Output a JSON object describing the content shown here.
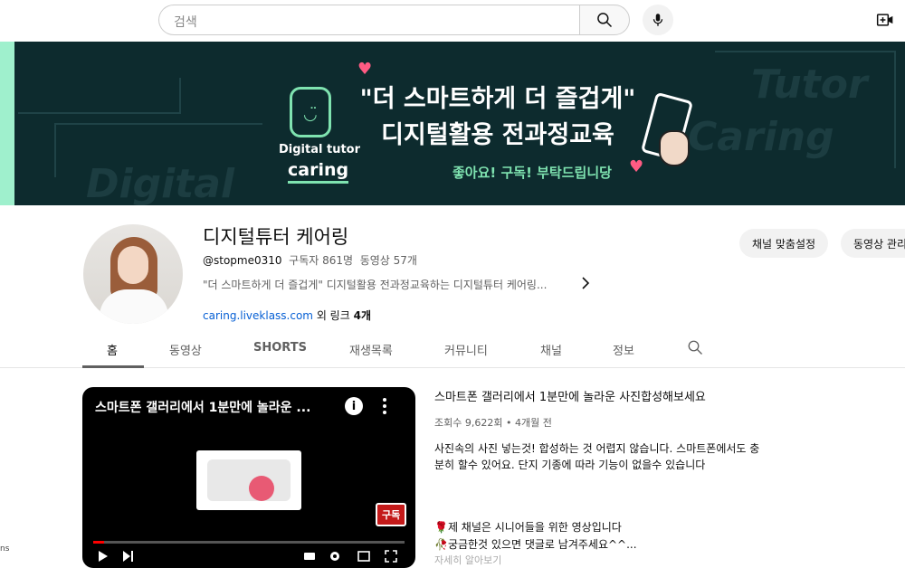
{
  "search": {
    "placeholder": "검색"
  },
  "banner": {
    "headline_line1": "\"더 스마트하게 더 즐겁게\"",
    "headline_line2": "디지털활용 전과정교육",
    "slogan": "좋아요! 구독! 부탁드립니당",
    "logo_tutor": "Digital tutor",
    "logo_caring": "caring",
    "bg_words": [
      "Digital",
      "Tutor",
      "Caring"
    ],
    "colors": {
      "background": "#0d2b2e",
      "accent": "#7fe3b0",
      "stripe": "#9ff0cd"
    }
  },
  "channel": {
    "name": "디지털튜터 케어링",
    "handle": "@stopme0310",
    "subscribers": "구독자 861명",
    "videos": "동영상 57개",
    "description": "\"더 스마트하게 더 즐겁게\" 디지털활용 전과정교육하는 디지털튜터 케어링...",
    "link": "caring.liveklass.com",
    "link_more": "외 링크",
    "link_more_count": "4개",
    "buttons": {
      "customize": "채널 맞춤설정",
      "manage": "동영상 관리"
    }
  },
  "tabs": [
    {
      "label": "홈",
      "active": true
    },
    {
      "label": "동영상",
      "active": false
    },
    {
      "label": "SHORTS",
      "active": false
    },
    {
      "label": "재생목록",
      "active": false
    },
    {
      "label": "커뮤니티",
      "active": false
    },
    {
      "label": "채널",
      "active": false
    },
    {
      "label": "정보",
      "active": false
    }
  ],
  "featured": {
    "player_title": "스마트폰 갤러리에서 1분만에 놀라운 ...",
    "subscribe_badge": "구독",
    "title": "스마트폰 갤러리에서 1분만에 놀라운 사진합성해보세요",
    "views": "조회수 9,622회",
    "age": "4개월 전",
    "description": "사진속의 사진 넣는것! 합성하는 것 어렵지 않습니다. 스마트폰에서도 충분히 할수 있어요. 단지 기종에 따라 기능이 없을수 있습니다",
    "line1": "🌹제 채널은 시니어들을 위한 영상입니다",
    "line2": "🥀궁금한것 있으면 댓글로 남겨주세요^^...",
    "line3_cut": "자세히 알아보기"
  },
  "misc": {
    "edge_text": "ns"
  }
}
